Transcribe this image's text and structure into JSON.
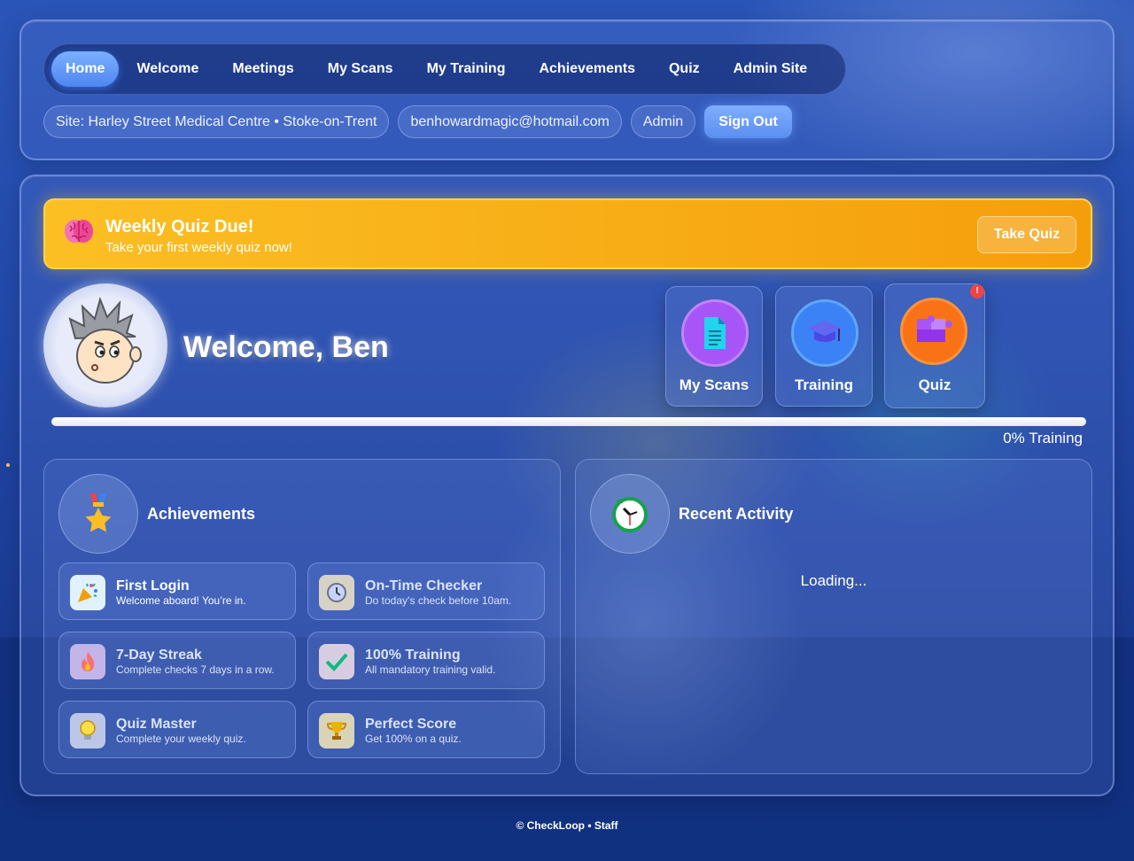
{
  "nav": {
    "items": [
      {
        "label": "Home",
        "active": true
      },
      {
        "label": "Welcome"
      },
      {
        "label": "Meetings"
      },
      {
        "label": "My Scans"
      },
      {
        "label": "My Training"
      },
      {
        "label": "Achievements"
      },
      {
        "label": "Quiz"
      },
      {
        "label": "Admin Site"
      }
    ]
  },
  "userbar": {
    "site": "Site: Harley Street Medical Centre • Stoke-on-Trent",
    "email": "benhowardmagic@hotmail.com",
    "role": "Admin",
    "signout_label": "Sign Out"
  },
  "banner": {
    "title": "Weekly Quiz Due!",
    "subtitle": "Take your first weekly quiz now!",
    "button_label": "Take Quiz",
    "icon": "brain-icon"
  },
  "welcome": {
    "heading": "Welcome, Ben",
    "avatar_icon": "cartoon-avatar"
  },
  "quick_tiles": [
    {
      "label": "My Scans",
      "icon": "document-icon",
      "color": "#a855f7"
    },
    {
      "label": "Training",
      "icon": "graduation-cap-icon",
      "color": "#3b82f6"
    },
    {
      "label": "Quiz",
      "icon": "puzzle-icon",
      "color": "#f97316",
      "badge": "!"
    }
  ],
  "progress": {
    "label": "0% Training",
    "value": 0
  },
  "achievements": {
    "title": "Achievements",
    "icon": "medal-icon",
    "items": [
      {
        "title": "First Login",
        "desc": "Welcome aboard! You’re in.",
        "icon": "party-popper-icon",
        "unlocked": true
      },
      {
        "title": "On-Time Checker",
        "desc": "Do today’s check before 10am.",
        "icon": "clock-icon",
        "unlocked": false
      },
      {
        "title": "7-Day Streak",
        "desc": "Complete checks 7 days in a row.",
        "icon": "flame-icon",
        "unlocked": false
      },
      {
        "title": "100% Training",
        "desc": "All mandatory training valid.",
        "icon": "checkmark-icon",
        "unlocked": false
      },
      {
        "title": "Quiz Master",
        "desc": "Complete your weekly quiz.",
        "icon": "lightbulb-icon",
        "unlocked": false
      },
      {
        "title": "Perfect Score",
        "desc": "Get 100% on a quiz.",
        "icon": "trophy-icon",
        "unlocked": false
      }
    ]
  },
  "activity": {
    "title": "Recent Activity",
    "icon": "alarm-clock-icon",
    "status": "Loading..."
  },
  "footer": {
    "text": "© CheckLoop • Staff"
  }
}
